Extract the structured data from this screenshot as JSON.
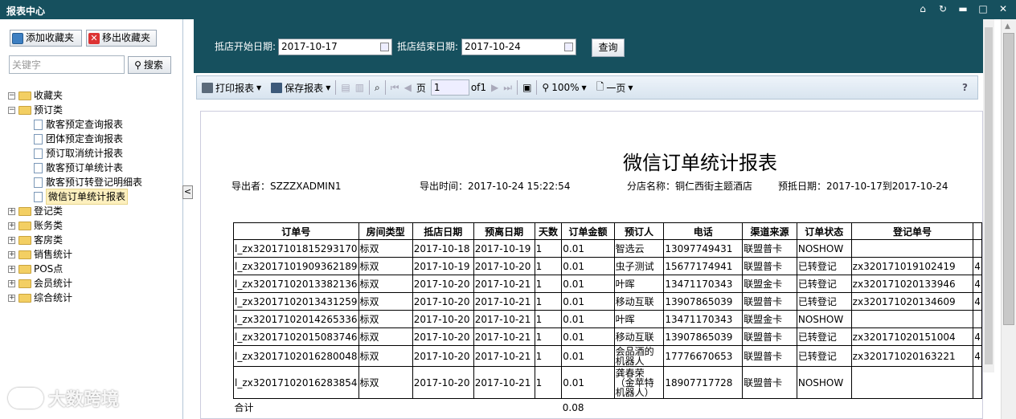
{
  "window": {
    "title": "报表中心"
  },
  "sidebar": {
    "add_fav_label": "添加收藏夹",
    "remove_fav_label": "移出收藏夹",
    "search_placeholder": "关键字",
    "search_button": "搜索",
    "tree": [
      {
        "label": "收藏夹",
        "expanded": true
      },
      {
        "label": "预订类",
        "expanded": true,
        "children": [
          "散客预定查询报表",
          "团体预定查询报表",
          "预订取消统计报表",
          "散客预订单统计表",
          "散客预订转登记明细表",
          "微信订单统计报表"
        ]
      },
      {
        "label": "登记类"
      },
      {
        "label": "账务类"
      },
      {
        "label": "客房类"
      },
      {
        "label": "销售统计"
      },
      {
        "label": "POS点"
      },
      {
        "label": "会员统计"
      },
      {
        "label": "综合统计"
      }
    ],
    "selected": "微信订单统计报表",
    "collapse_glyph": "<"
  },
  "filter": {
    "start_label": "抵店开始日期:",
    "start_value": "2017-10-17",
    "end_label": "抵店结束日期:",
    "end_value": "2017-10-24",
    "query_button": "查询"
  },
  "toolbar": {
    "print": "打印报表",
    "save": "保存报表",
    "page_label": "页",
    "page_value": "1",
    "of_label": "of1",
    "zoom": "100%",
    "view": "一页",
    "help": "?"
  },
  "report": {
    "title": "微信订单统计报表",
    "exporter": "导出者：SZZZXADMIN1",
    "export_time": "导出时间：2017-10-24 15:22:54",
    "branch": "分店名称：铜仁西街主题酒店",
    "arrival_range": "预抵日期：2017-10-17到2017-10-24",
    "columns": [
      "订单号",
      "房间类型",
      "抵店日期",
      "预离日期",
      "天数",
      "订单金额",
      "预订人",
      "电话",
      "渠道来源",
      "订单状态",
      "登记单号",
      ""
    ],
    "rows": [
      [
        "l_zx32017101815293170",
        "标双",
        "2017-10-18",
        "2017-10-19",
        "1",
        "0.01",
        "智选云",
        "13097749431",
        "联盟普卡",
        "NOSHOW",
        "",
        ""
      ],
      [
        "l_zx32017101909362189",
        "标双",
        "2017-10-19",
        "2017-10-20",
        "1",
        "0.01",
        "虫子测试",
        "15677174941",
        "联盟普卡",
        "已转登记",
        "zx320171019102419",
        "4"
      ],
      [
        "l_zx32017102013382136",
        "标双",
        "2017-10-20",
        "2017-10-21",
        "1",
        "0.01",
        "叶晖",
        "13471170343",
        "联盟金卡",
        "已转登记",
        "zx320171020133946",
        "4"
      ],
      [
        "l_zx32017102013431259",
        "标双",
        "2017-10-20",
        "2017-10-21",
        "1",
        "0.01",
        "移动互联",
        "13907865039",
        "联盟普卡",
        "已转登记",
        "zx320171020134609",
        "4"
      ],
      [
        "l_zx32017102014265336",
        "标双",
        "2017-10-20",
        "2017-10-21",
        "1",
        "0.01",
        "叶晖",
        "13471170343",
        "联盟金卡",
        "NOSHOW",
        "",
        ""
      ],
      [
        "l_zx32017102015083746",
        "标双",
        "2017-10-20",
        "2017-10-21",
        "1",
        "0.01",
        "移动互联",
        "13907865039",
        "联盟普卡",
        "已转登记",
        "zx320171020151004",
        "4"
      ],
      [
        "l_zx32017102016280048",
        "标双",
        "2017-10-20",
        "2017-10-21",
        "1",
        "0.01",
        "会品酒的机器人",
        "17776670653",
        "联盟普卡",
        "已转登记",
        "zx320171020163221",
        "4"
      ],
      [
        "l_zx32017102016283854",
        "标双",
        "2017-10-20",
        "2017-10-21",
        "1",
        "0.01",
        "龚春荣（金苹特机器人）",
        "18907717728",
        "联盟普卡",
        "NOSHOW",
        "",
        ""
      ]
    ],
    "total_label": "合计",
    "total_amount": "0.08"
  },
  "watermark": "大数跨境"
}
